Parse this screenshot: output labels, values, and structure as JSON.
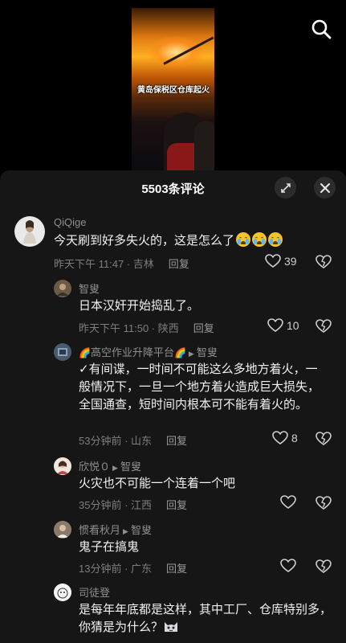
{
  "video": {
    "caption": "黄岛保税区仓库起火"
  },
  "panel": {
    "title": "5503条评论"
  },
  "comments": [
    {
      "author": "QiQige",
      "text": "今天刷到好多失火的，这是怎么了",
      "emoji": [
        "loudly-crying-face",
        "loudly-crying-face",
        "loudly-crying-face"
      ],
      "time_location": "昨天下午 11:47 · 吉林",
      "reply_label": "回复",
      "likes": "39"
    },
    {
      "author": "智叟",
      "text": "日本汉奸开始捣乱了。",
      "time_location": "昨天下午 11:50 · 陕西",
      "reply_label": "回复",
      "likes": "10"
    },
    {
      "author": "高空作业升降平台",
      "reply_to": "智叟",
      "text": "✓有间谍，一时间不可能这么多地方着火，一般情况下，一旦一个地方着火造成巨大损失，全国通查，短时间内根本可不能有着火的。",
      "time_location": "53分钟前 · 山东",
      "reply_label": "回复",
      "likes": "8"
    },
    {
      "author": "欣悦０",
      "reply_to": "智叟",
      "text": "火灾也不可能一个连着一个吧",
      "time_location": "35分钟前 · 江西",
      "reply_label": "回复"
    },
    {
      "author": "惯看秋月",
      "reply_to": "智叟",
      "text": "鬼子在搞鬼",
      "time_location": "13分钟前 · 广东",
      "reply_label": "回复"
    },
    {
      "author": "司徒登",
      "text": "是每年年底都是这样，其中工厂、仓库特别多，你猜是为什么？",
      "emoji": [
        "cat-face"
      ]
    }
  ],
  "colors": {
    "panel_bg": "#161616",
    "text_primary": "#f2f2f2",
    "text_secondary": "#7d7d7d"
  }
}
